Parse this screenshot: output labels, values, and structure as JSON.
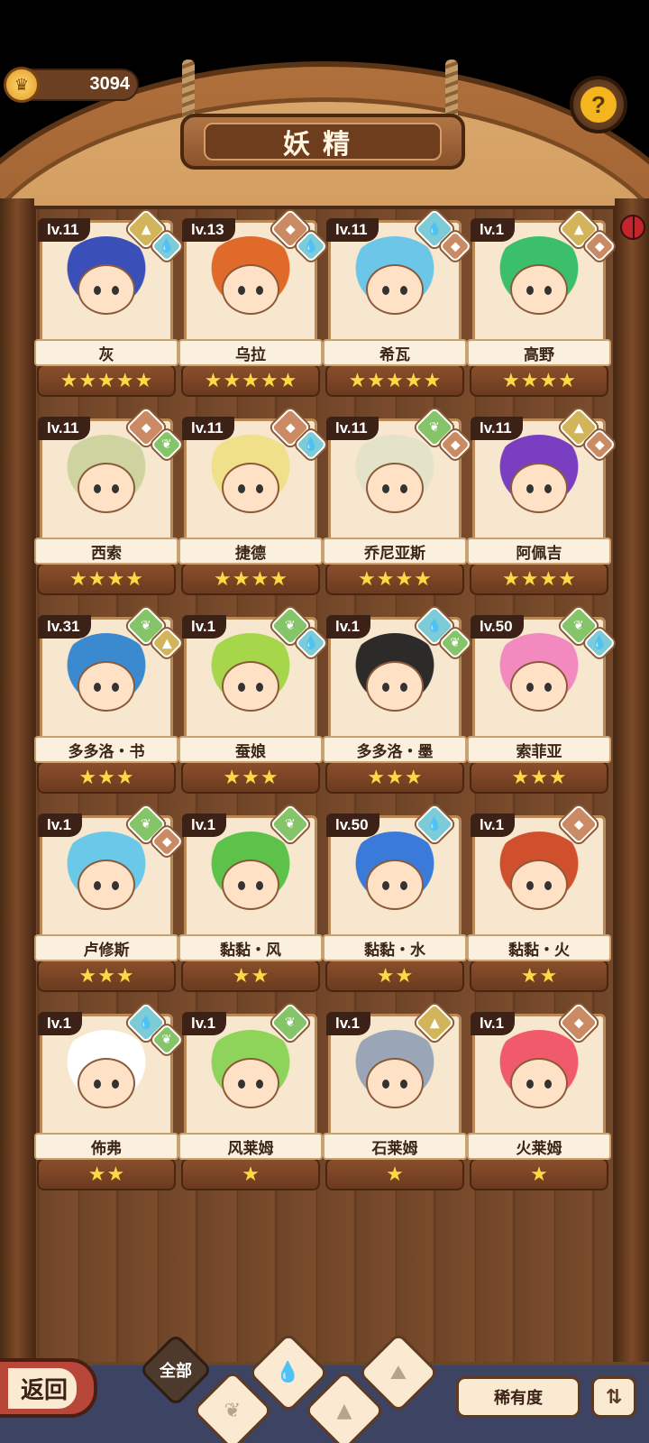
{
  "header": {
    "coins": "3094",
    "title": "妖精",
    "help_label": "?"
  },
  "fairies": [
    {
      "level": "lv.11",
      "name": "灰",
      "stars": 5,
      "elements": [
        "earth",
        "water"
      ],
      "hair": "#3b4fb8"
    },
    {
      "level": "lv.13",
      "name": "乌拉",
      "stars": 5,
      "elements": [
        "fire",
        "water"
      ],
      "hair": "#e06a2a"
    },
    {
      "level": "lv.11",
      "name": "希瓦",
      "stars": 5,
      "elements": [
        "water",
        "fire"
      ],
      "hair": "#6cc6e8"
    },
    {
      "level": "lv.1",
      "name": "高野",
      "stars": 4,
      "elements": [
        "earth",
        "fire"
      ],
      "hair": "#3bbf6a"
    },
    {
      "level": "lv.11",
      "name": "西索",
      "stars": 4,
      "elements": [
        "fire",
        "wind"
      ],
      "hair": "#cfd3a0"
    },
    {
      "level": "lv.11",
      "name": "捷德",
      "stars": 4,
      "elements": [
        "fire",
        "water"
      ],
      "hair": "#f0e08a"
    },
    {
      "level": "lv.11",
      "name": "乔尼亚斯",
      "stars": 4,
      "elements": [
        "wind",
        "fire"
      ],
      "hair": "#e4e2c8"
    },
    {
      "level": "lv.11",
      "name": "阿佩吉",
      "stars": 4,
      "elements": [
        "earth",
        "fire"
      ],
      "hair": "#7a3fc0"
    },
    {
      "level": "lv.31",
      "name": "多多洛・书",
      "stars": 3,
      "elements": [
        "wind",
        "earth"
      ],
      "hair": "#3b8ad0"
    },
    {
      "level": "lv.1",
      "name": "蚕娘",
      "stars": 3,
      "elements": [
        "wind",
        "water"
      ],
      "hair": "#a6d64a"
    },
    {
      "level": "lv.1",
      "name": "多多洛・墨",
      "stars": 3,
      "elements": [
        "water",
        "wind"
      ],
      "hair": "#2d2a2a"
    },
    {
      "level": "lv.50",
      "name": "索菲亚",
      "stars": 3,
      "elements": [
        "wind",
        "water"
      ],
      "hair": "#f28ac0"
    },
    {
      "level": "lv.1",
      "name": "卢修斯",
      "stars": 3,
      "elements": [
        "wind",
        "fire"
      ],
      "hair": "#6ac8e8"
    },
    {
      "level": "lv.1",
      "name": "黏黏・风",
      "stars": 2,
      "elements": [
        "wind"
      ],
      "hair": "#5cc24a"
    },
    {
      "level": "lv.50",
      "name": "黏黏・水",
      "stars": 2,
      "elements": [
        "water"
      ],
      "hair": "#3a7ad8"
    },
    {
      "level": "lv.1",
      "name": "黏黏・火",
      "stars": 2,
      "elements": [
        "fire"
      ],
      "hair": "#d0502e"
    },
    {
      "level": "lv.1",
      "name": "佈弗",
      "stars": 2,
      "elements": [
        "water",
        "wind"
      ],
      "hair": "#ffffff"
    },
    {
      "level": "lv.1",
      "name": "风莱姆",
      "stars": 1,
      "elements": [
        "wind"
      ],
      "hair": "#8ed35a"
    },
    {
      "level": "lv.1",
      "name": "石莱姆",
      "stars": 1,
      "elements": [
        "earth"
      ],
      "hair": "#9aa6b8"
    },
    {
      "level": "lv.1",
      "name": "火莱姆",
      "stars": 1,
      "elements": [
        "fire"
      ],
      "hair": "#f05a6a"
    }
  ],
  "footer": {
    "back_label": "返回",
    "filter_all": "全部",
    "rarity_label": "稀有度"
  }
}
